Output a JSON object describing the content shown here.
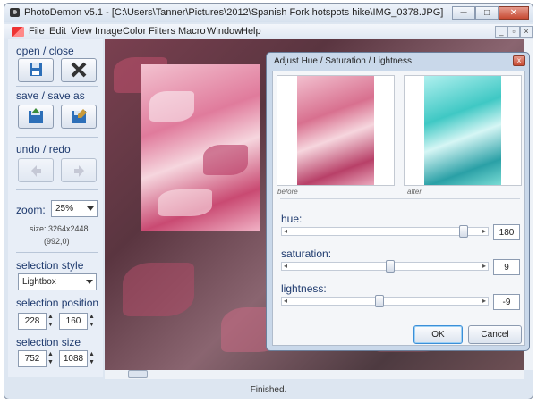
{
  "window": {
    "title": "PhotoDemon v5.1 - [C:\\Users\\Tanner\\Pictures\\2012\\Spanish Fork hotspots hike\\IMG_0378.JPG]",
    "minimize": "─",
    "maximize": "□",
    "close": "✕"
  },
  "menu": {
    "items": [
      "File",
      "Edit",
      "View",
      "Image",
      "Color",
      "Filters",
      "Macro",
      "Window",
      "Help"
    ],
    "mdi": [
      "_",
      "▫",
      "×"
    ]
  },
  "left_panel": {
    "open_close": "open / close",
    "save_saveas": "save / save as",
    "undo_redo": "undo / redo",
    "zoom_label": "zoom:",
    "zoom_value": "25%",
    "size_text": "size: 3264x2448",
    "coords_text": "(992,0)",
    "selection_style": "selection style",
    "selection_style_value": "Lightbox",
    "selection_position": "selection position",
    "pos_x": "228",
    "pos_y": "160",
    "selection_size": "selection size",
    "size_w": "752",
    "size_h": "1088"
  },
  "status": "Finished.",
  "dialog": {
    "title": "Adjust Hue / Saturation / Lightness",
    "close": "x",
    "before": "before",
    "after": "after",
    "hue_label": "hue:",
    "hue_value": "180",
    "saturation_label": "saturation:",
    "saturation_value": "9",
    "lightness_label": "lightness:",
    "lightness_value": "-9",
    "ok": "OK",
    "cancel": "Cancel",
    "hue_fraction": 0.94,
    "saturation_fraction": 0.53,
    "lightness_fraction": 0.47
  },
  "colors": {
    "accent": "#1e3a6e",
    "close_red": "#c74b33",
    "ok_focus": "#3c8fd8"
  }
}
